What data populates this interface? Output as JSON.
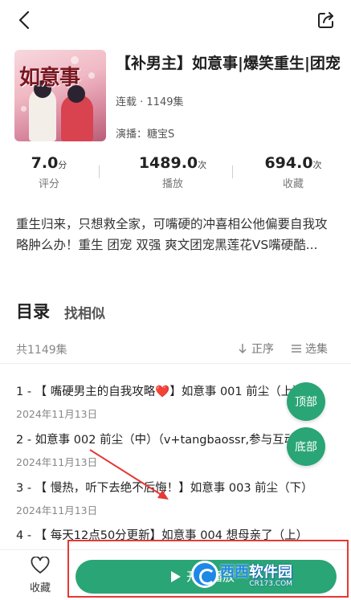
{
  "header": {
    "back_icon": "back-chevron-icon",
    "share_icon": "share-icon"
  },
  "album": {
    "cover_title": "如意事",
    "title": "【补男主】如意事|爆笑重生|团宠",
    "status": "连载 · 1149集",
    "narrator": "演播：糖宝S"
  },
  "stats": [
    {
      "value": "7.0",
      "unit": "分",
      "label": "评分"
    },
    {
      "value": "1489.0",
      "unit": "次",
      "label": "播放"
    },
    {
      "value": "694.0",
      "unit": "次",
      "label": "收藏"
    }
  ],
  "description": "重生归来，只想救全家，可嘴硬的冲喜相公他偏要自我攻略肿么办！重生 团宠 双强 爽文团宠黑莲花VS嘴硬酷...",
  "tabs": {
    "catalog": "目录",
    "similar": "找相似"
  },
  "list_header": {
    "count": "共1149集",
    "sort": "正序",
    "select": "选集"
  },
  "episodes": [
    {
      "title": "1 - 【 嘴硬男主的自我攻略❤️】如意事 001 前尘（上）",
      "date": "2024年11月13日"
    },
    {
      "title": "2 - 如意事 002 前尘（中）（v+tangbaossr,参与互动）",
      "date": "2024年11月13日"
    },
    {
      "title": "3 - 【 慢热，听下去绝不后悔！】如意事 003 前尘（下）",
      "date": "2024年11月13日"
    },
    {
      "title": "4 - 【 每天12点50分更新】如意事 004 想母亲了（上）",
      "date": ""
    }
  ],
  "float_buttons": {
    "top": "顶部",
    "bottom": "底部"
  },
  "bottom_bar": {
    "fav_label": "收藏",
    "play_label": "开始播放"
  },
  "watermark": {
    "main_a": "西西",
    "main_b": "软件园",
    "sub": "CR173.COM"
  },
  "colors": {
    "accent": "#2aa575",
    "highlight": "#e53935"
  }
}
